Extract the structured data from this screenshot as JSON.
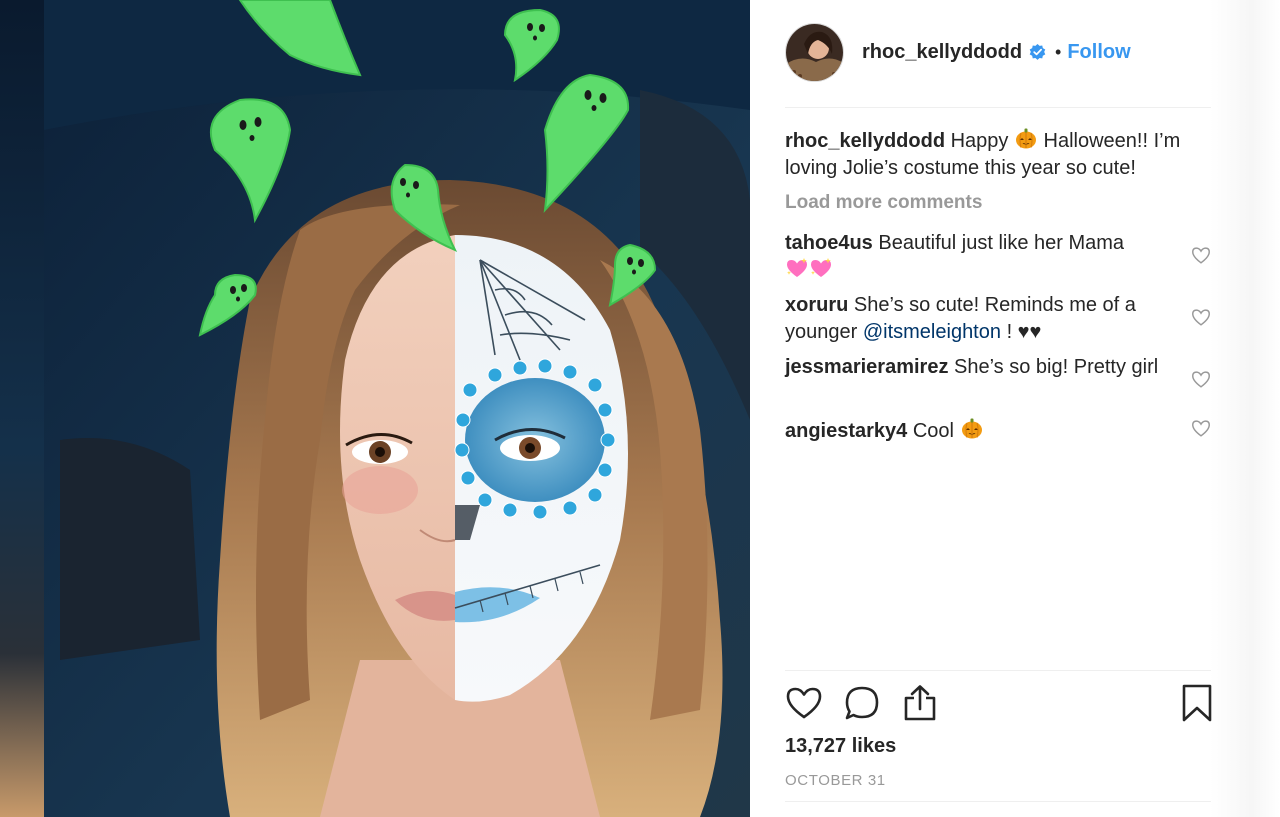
{
  "post": {
    "author": {
      "username": "rhoc_kellyddodd",
      "verified": true,
      "follow_label": "Follow",
      "separator": "•"
    },
    "caption": {
      "username": "rhoc_kellyddodd",
      "text_before_emoji": "Happy",
      "emoji": "pumpkin-icon",
      "text_after_emoji": "Halloween!! I’m loving Jolie’s costume this year so cute!"
    },
    "load_more_label": "Load more comments",
    "comments": [
      {
        "username": "tahoe4us",
        "text": "Beautiful just like her Mama",
        "emoji": "sparkling-heart-icon"
      },
      {
        "username": "xoruru",
        "text": "She’s so cute! Reminds me of a younger",
        "mention": "@itsmeleighton",
        "suffix": "! ♥♥"
      },
      {
        "username": "jessmarieramirez",
        "text": "She’s so big! Pretty girl"
      },
      {
        "username": "angiestarky4",
        "text": "Cool",
        "emoji": "pumpkin-icon"
      }
    ],
    "likes_label": "13,727 likes",
    "date_label": "OCTOBER 31"
  },
  "colors": {
    "link_blue": "#3897f0",
    "mention_blue": "#003569",
    "muted_gray": "#999999",
    "ghost_green": "#52e06a"
  }
}
